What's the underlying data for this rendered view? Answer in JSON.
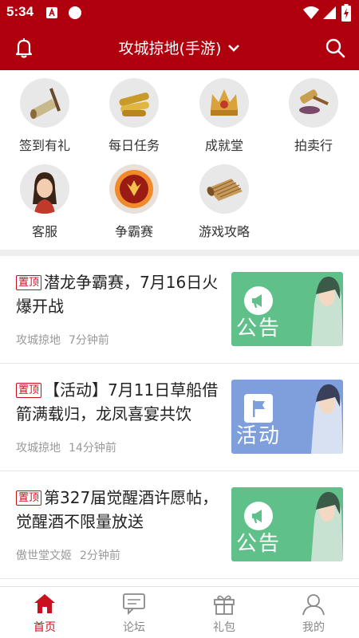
{
  "status_bar": {
    "time": "5:34"
  },
  "header": {
    "title": "攻城掠地(手游)"
  },
  "quick_menu": [
    {
      "label": "签到有礼",
      "icon": "scroll-icon"
    },
    {
      "label": "每日任务",
      "icon": "gold-scrolls-icon"
    },
    {
      "label": "成就堂",
      "icon": "crown-icon"
    },
    {
      "label": "拍卖行",
      "icon": "auction-hammer-icon"
    },
    {
      "label": "客服",
      "icon": "service-avatar-icon"
    },
    {
      "label": "争霸赛",
      "icon": "dragon-emblem-icon"
    },
    {
      "label": "游戏攻略",
      "icon": "bamboo-scroll-icon"
    }
  ],
  "articles": [
    {
      "pin": "置顶",
      "title": "潜龙争霸赛，7月16日火爆开战",
      "author": "攻城掠地",
      "time": "7分钟前",
      "thumb_label": "公告",
      "thumb_kind": "announcement",
      "thumb_color": "#5fc08a"
    },
    {
      "pin": "置顶",
      "title": "【活动】7月11日草船借箭满载归，龙凤喜宴共饮",
      "author": "攻城掠地",
      "time": "14分钟前",
      "thumb_label": "活动",
      "thumb_kind": "event",
      "thumb_color": "#7f9fdc"
    },
    {
      "pin": "置顶",
      "title": "第327届觉醒酒许愿帖，觉醒酒不限量放送",
      "author": "傲世堂文姬",
      "time": "2分钟前",
      "thumb_label": "公告",
      "thumb_kind": "announcement",
      "thumb_color": "#5fc08a"
    }
  ],
  "bottom_nav": [
    {
      "label": "首页",
      "active": true,
      "icon": "home-icon"
    },
    {
      "label": "论坛",
      "active": false,
      "icon": "forum-icon"
    },
    {
      "label": "礼包",
      "active": false,
      "icon": "gift-icon"
    },
    {
      "label": "我的",
      "active": false,
      "icon": "profile-icon"
    }
  ],
  "colors": {
    "brand": "#b0000d",
    "accent": "#c8101e",
    "announcement": "#5fc08a",
    "event": "#7f9fdc"
  }
}
